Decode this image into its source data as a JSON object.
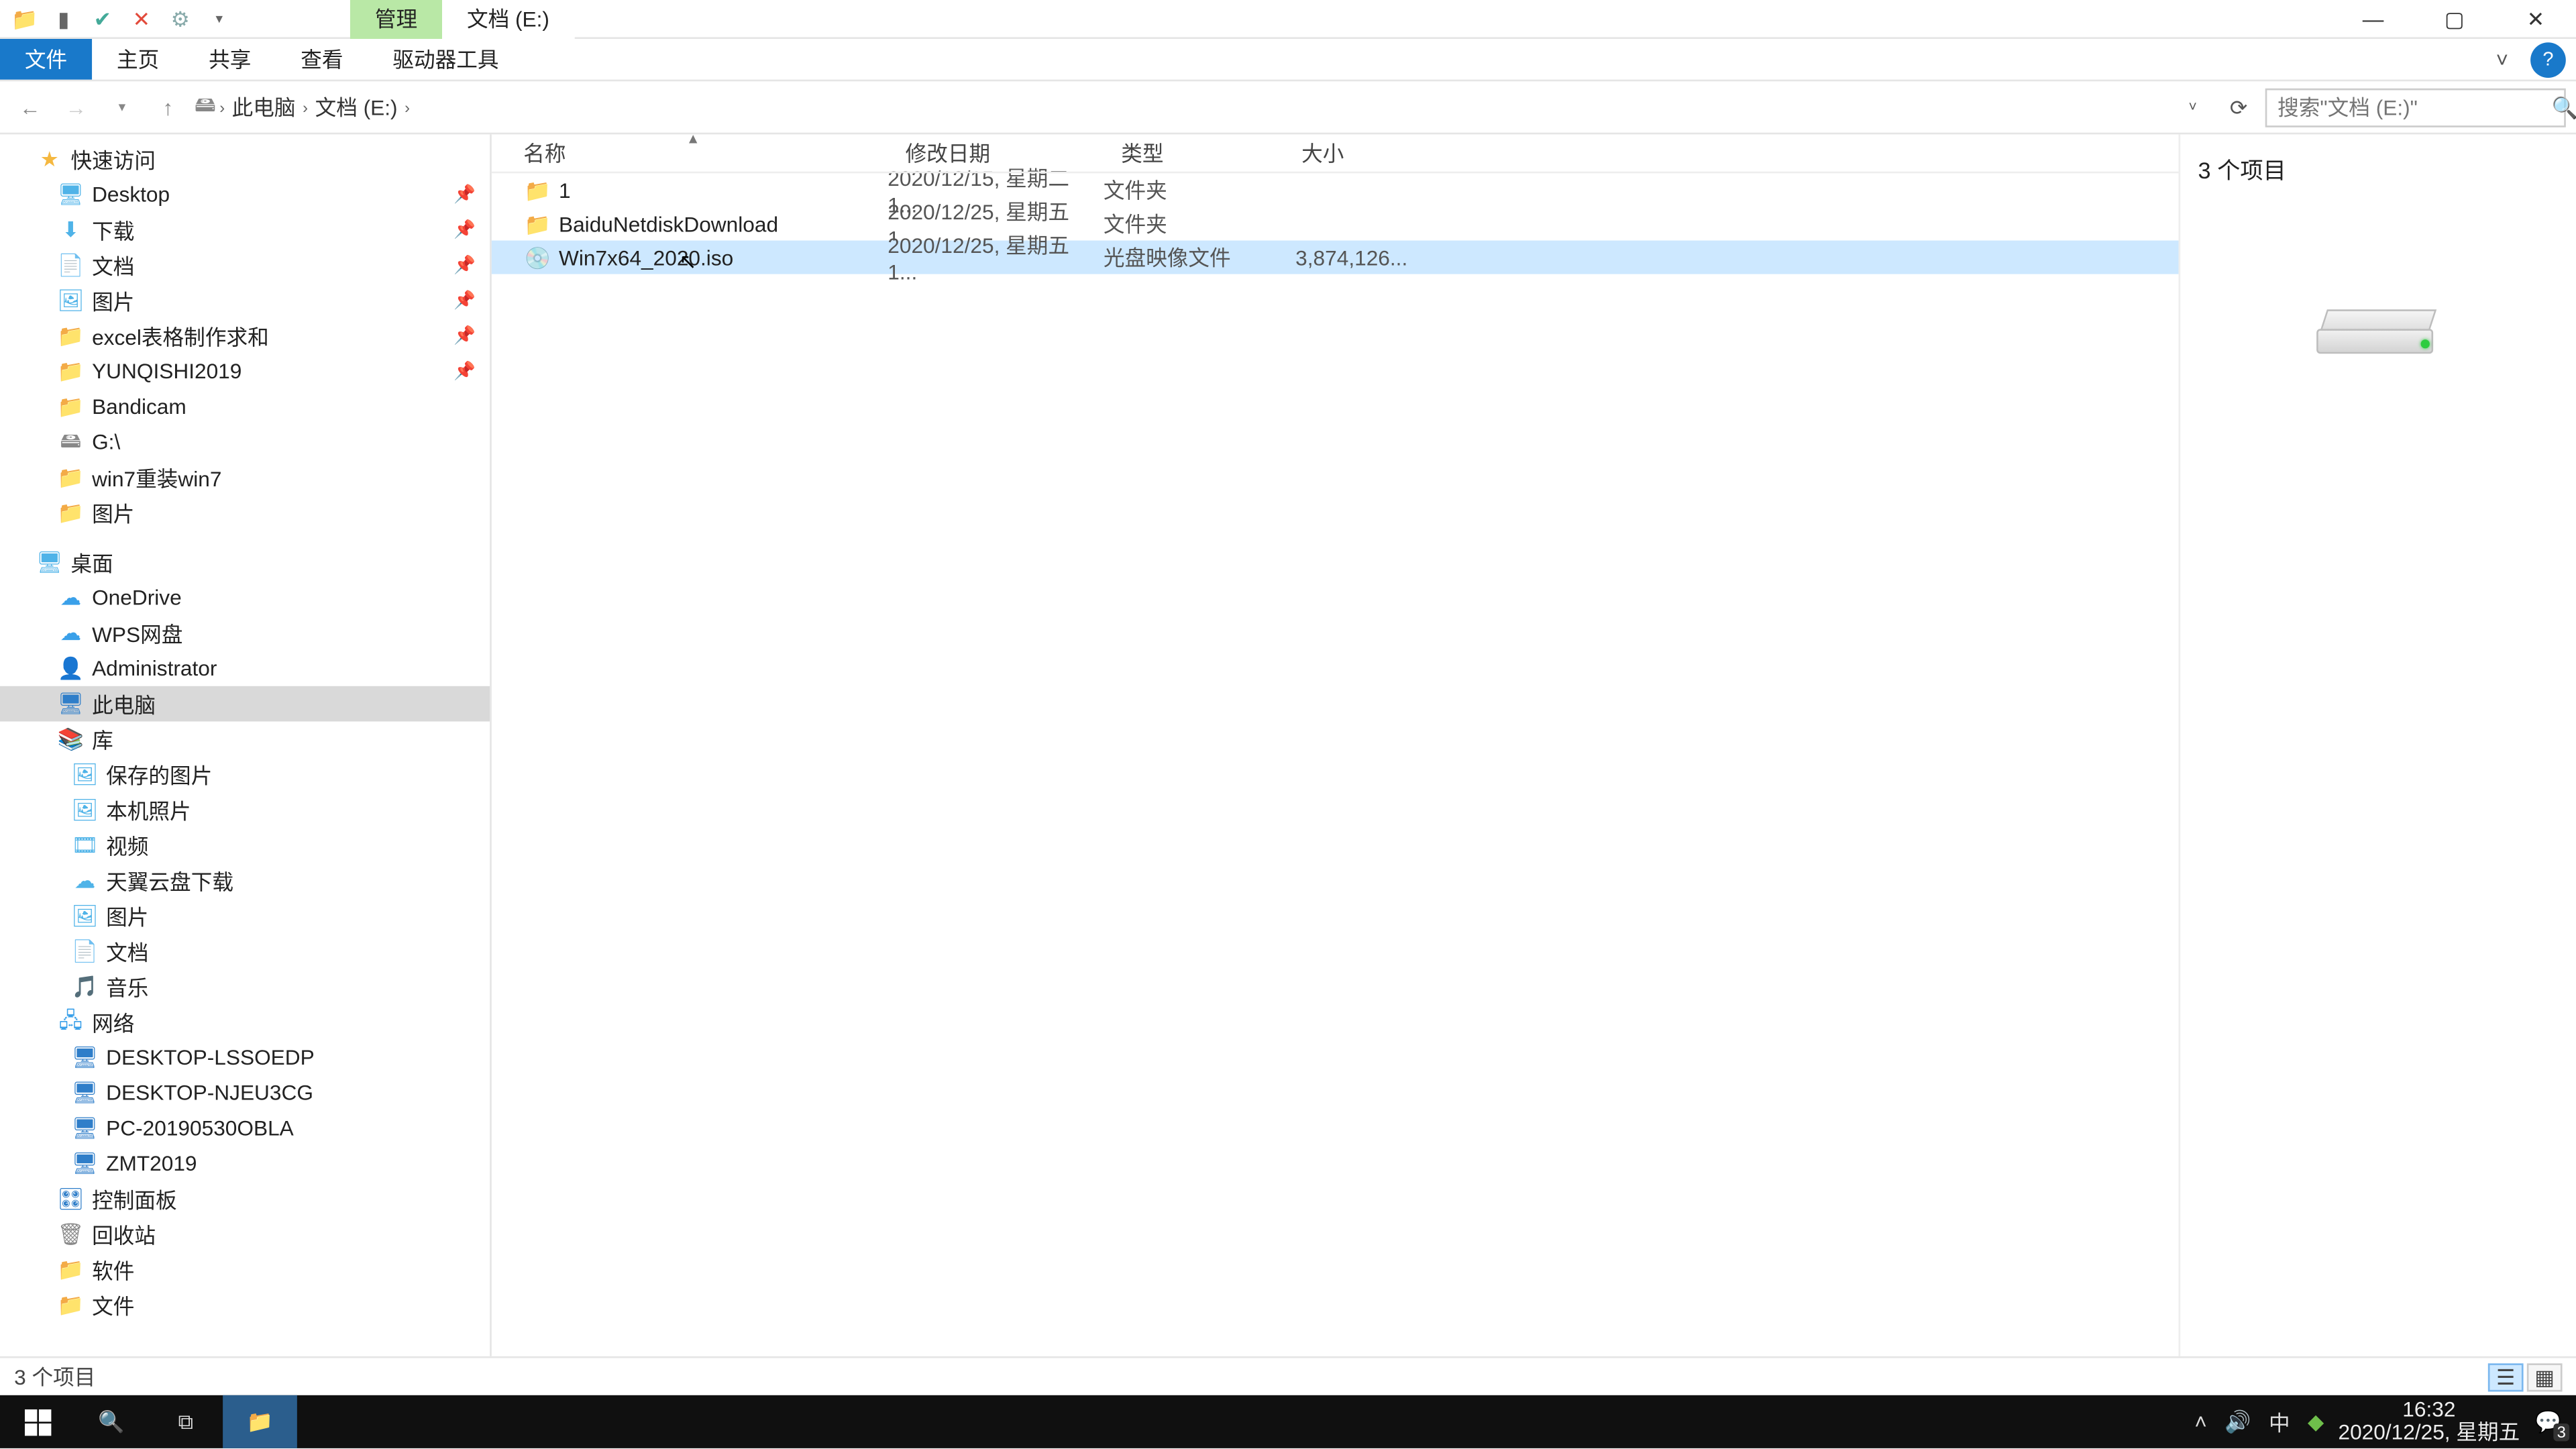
{
  "title_tab_manage": "管理",
  "title_tab_path": "文档 (E:)",
  "ribbon": {
    "file": "文件",
    "home": "主页",
    "share": "共享",
    "view": "查看",
    "drive": "驱动器工具"
  },
  "breadcrumb": {
    "root": "此电脑",
    "drive": "文档 (E:)"
  },
  "search": {
    "placeholder": "搜索\"文档 (E:)\""
  },
  "nav": {
    "quick": "快速访问",
    "quick_items": [
      "Desktop",
      "下载",
      "文档",
      "图片",
      "excel表格制作求和",
      "YUNQISHI2019",
      "Bandicam",
      "G:\\",
      "win7重装win7",
      "图片"
    ],
    "desktop": "桌面",
    "desktop_items": [
      "OneDrive",
      "WPS网盘",
      "Administrator",
      "此电脑",
      "库"
    ],
    "lib_items": [
      "保存的图片",
      "本机照片",
      "视频",
      "天翼云盘下载",
      "图片",
      "文档",
      "音乐"
    ],
    "network": "网络",
    "net_items": [
      "DESKTOP-LSSOEDP",
      "DESKTOP-NJEU3CG",
      "PC-20190530OBLA",
      "ZMT2019"
    ],
    "control": "控制面板",
    "recycle": "回收站",
    "soft": "软件",
    "docs": "文件"
  },
  "cols": {
    "name": "名称",
    "date": "修改日期",
    "type": "类型",
    "size": "大小"
  },
  "rows": [
    {
      "name": "1",
      "date": "2020/12/15, 星期二 1...",
      "type": "文件夹",
      "size": "",
      "icon": "folder"
    },
    {
      "name": "BaiduNetdiskDownload",
      "date": "2020/12/25, 星期五 1...",
      "type": "文件夹",
      "size": "",
      "icon": "folder"
    },
    {
      "name": "Win7x64_2020.iso",
      "date": "2020/12/25, 星期五 1...",
      "type": "光盘映像文件",
      "size": "3,874,126...",
      "icon": "iso"
    }
  ],
  "preview": {
    "count": "3 个项目"
  },
  "status": {
    "text": "3 个项目"
  },
  "tray": {
    "ime": "中",
    "time": "16:32",
    "date": "2020/12/25, 星期五",
    "notif": "3"
  }
}
